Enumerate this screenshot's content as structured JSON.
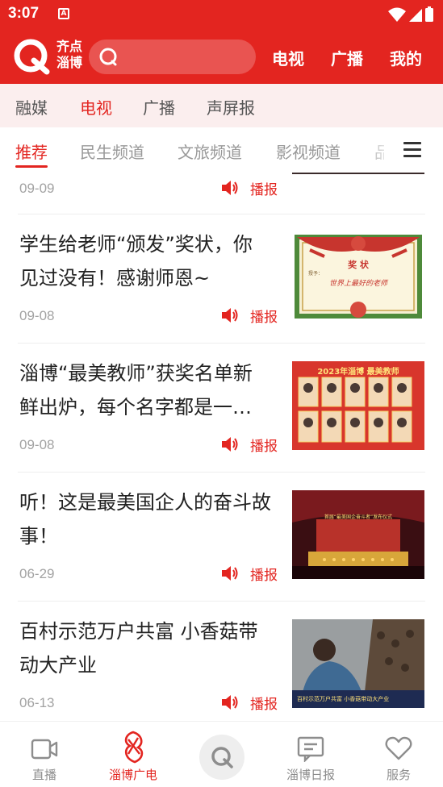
{
  "status": {
    "time": "3:07",
    "notify_badge": "A"
  },
  "header": {
    "logo_text_1": "齐点",
    "logo_text_2": "淄博",
    "search_placeholder": "",
    "nav": [
      "电视",
      "广播",
      "我的"
    ]
  },
  "categories": [
    "融媒",
    "电视",
    "广播",
    "声屏报"
  ],
  "active_category": "电视",
  "channels": [
    "推荐",
    "民生频道",
    "文旅频道",
    "影视频道",
    "品"
  ],
  "active_channel": "推荐",
  "items": [
    {
      "title": "",
      "date": "09-09",
      "play_label": "播报"
    },
    {
      "title": "学生给老师“颁发”奖状，你见过没有！感谢师恩~",
      "date": "09-08",
      "play_label": "播报"
    },
    {
      "title": "淄博“最美教师”获奖名单新鲜出炉，每个名字都是一…",
      "date": "09-08",
      "play_label": "播报"
    },
    {
      "title": "听！这是最美国企人的奋斗故事！",
      "date": "06-29",
      "play_label": "播报"
    },
    {
      "title": "百村示范万户共富 小香菇带动大产业",
      "date": "06-13",
      "play_label": "播报"
    }
  ],
  "thumbs": {
    "certificate_title": "奖 状",
    "certificate_line": "世界上最好的老师",
    "certificate_to": "授予：",
    "teacher_banner": "2023年淄博 最美教师",
    "stage_banner": "首届“最美国企奋斗者”发布仪式",
    "mushroom_caption": "百村示范万户共富 小香菇带动大产业"
  },
  "tabs": [
    {
      "label": "直播",
      "icon": "video-camera-icon"
    },
    {
      "label": "淄博广电",
      "icon": "zibo-broadcast-logo-icon"
    },
    {
      "label": "",
      "icon": "qidian-logo-icon"
    },
    {
      "label": "淄博日报",
      "icon": "newspaper-icon"
    },
    {
      "label": "服务",
      "icon": "heart-icon"
    }
  ],
  "active_tab": "淄博广电",
  "colors": {
    "brand_red": "#e32520",
    "category_bg": "#fbeeee",
    "muted": "#a3a3a3"
  }
}
